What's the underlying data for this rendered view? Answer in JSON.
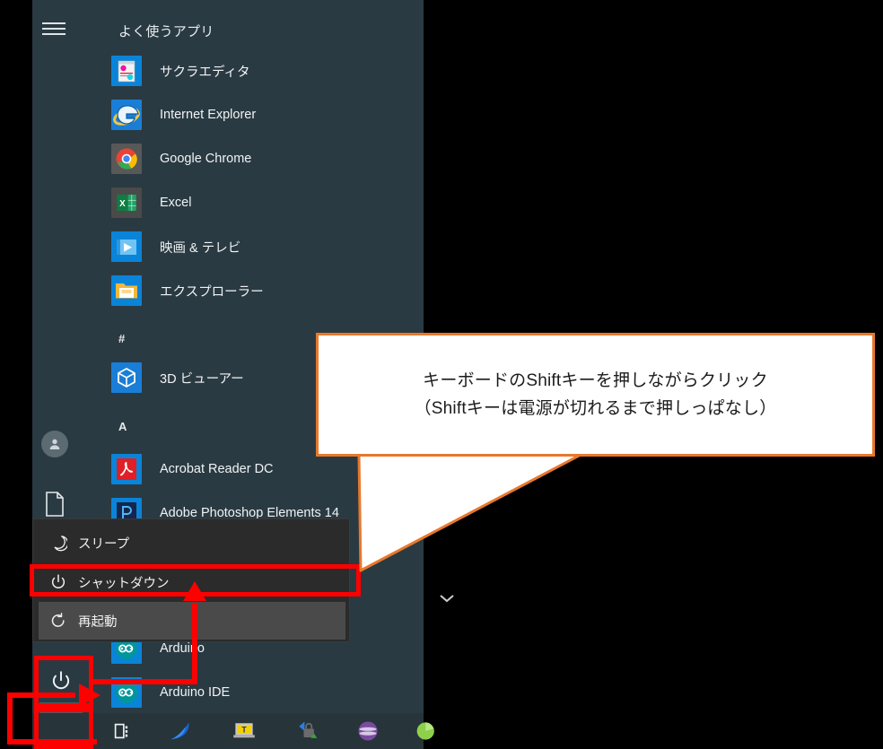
{
  "window": {
    "os": "Windows 10",
    "surface": "start-menu"
  },
  "start_menu": {
    "hamburger_label": "",
    "frequent_header": "よく使うアプリ",
    "frequent_apps": [
      {
        "label": "サクラエディタ",
        "icon": "sakura-editor-icon"
      },
      {
        "label": "Internet Explorer",
        "icon": "internet-explorer-icon"
      },
      {
        "label": "Google Chrome",
        "icon": "google-chrome-icon"
      },
      {
        "label": "Excel",
        "icon": "excel-icon"
      },
      {
        "label": "映画 & テレビ",
        "icon": "movies-tv-icon"
      },
      {
        "label": "エクスプローラー",
        "icon": "file-explorer-icon"
      }
    ],
    "groups": [
      {
        "heading": "#",
        "apps": [
          {
            "label": "3D ビューアー",
            "icon": "3d-viewer-icon"
          }
        ]
      },
      {
        "heading": "A",
        "apps": [
          {
            "label": "Acrobat Reader DC",
            "icon": "acrobat-reader-icon"
          },
          {
            "label": "Adobe Photoshop Elements 14",
            "icon": "photoshop-elements-icon"
          },
          {
            "label": "Arduino",
            "icon": "arduino-icon"
          },
          {
            "label": "Arduino IDE",
            "icon": "arduino-ide-icon"
          }
        ]
      }
    ],
    "rail": {
      "account_icon": "user-account-icon",
      "documents_icon": "documents-icon",
      "power_icon": "power-icon",
      "start_icon": "windows-start-icon"
    },
    "scroll_chevron_icon": "chevron-down-icon"
  },
  "power_menu": {
    "items": [
      {
        "label": "スリープ",
        "icon": "moon-icon",
        "state": "normal"
      },
      {
        "label": "シャットダウン",
        "icon": "power-icon",
        "state": "annotated"
      },
      {
        "label": "再起動",
        "icon": "restart-icon",
        "state": "hover"
      }
    ]
  },
  "callout": {
    "text": "キーボードのShiftキーを押しながらクリック\n（Shiftキーは電源が切れるまで押しっぱなし）",
    "border_color": "#e8782d",
    "background_color": "#ffffff",
    "text_color": "#1b1b1b"
  },
  "annotations": {
    "highlight_color": "#ff0000",
    "targets": [
      "shutdown-menu-item",
      "power-rail-button",
      "windows-start-button"
    ]
  },
  "taskbar": {
    "items": [
      {
        "name": "task-view-icon"
      },
      {
        "name": "wireshark-icon"
      },
      {
        "name": "tera-term-icon"
      },
      {
        "name": "winscp-icon"
      },
      {
        "name": "eclipse-icon"
      },
      {
        "name": "green-app-icon"
      }
    ],
    "background_color": "#27343a"
  },
  "colors": {
    "start_background": "#2a3a42",
    "popup_background": "#2b2b2b",
    "popup_hover": "#4a4a4a",
    "start_button_background": "#4b5c64",
    "text_primary": "#f0f3f5"
  }
}
